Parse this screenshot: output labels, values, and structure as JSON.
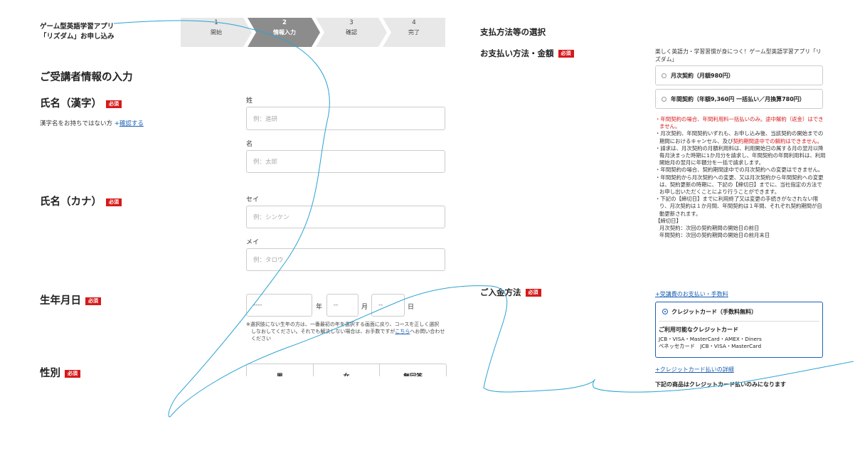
{
  "brand": {
    "line1": "ゲーム型英語学習アプリ",
    "line2": "「リズダム」お申し込み"
  },
  "steps": [
    {
      "num": "1",
      "label": "開始"
    },
    {
      "num": "2",
      "label": "情報入力"
    },
    {
      "num": "3",
      "label": "確認"
    },
    {
      "num": "4",
      "label": "完了"
    }
  ],
  "left": {
    "heading": "ご受講者情報の入力",
    "required": "必須",
    "name_kanji": {
      "title": "氏名（漢字）",
      "note_text": "漢字名をお持ちではない方",
      "note_link": "+確認する",
      "last_label": "姓",
      "last_placeholder": "例：進研",
      "first_label": "名",
      "first_placeholder": "例：太郎"
    },
    "name_kana": {
      "title": "氏名（カナ）",
      "last_label": "セイ",
      "last_placeholder": "例：シンケン",
      "first_label": "メイ",
      "first_placeholder": "例：タロウ"
    },
    "birthdate": {
      "title": "生年月日",
      "year_value": "----",
      "year_unit": "年",
      "month_value": "--",
      "month_unit": "月",
      "day_value": "--",
      "day_unit": "日",
      "note_a": "※選択肢にない生年の方は、一番最初の年を選択する画面に戻り、コースを正しく選択",
      "note_b": "しなおしてください。それでも解決しない場合は、お手数ですが",
      "note_link": "こちら",
      "note_c": "へお問い合わせ",
      "note_d": "ください"
    },
    "gender": {
      "title": "性別",
      "options": [
        "男",
        "女",
        "無回答"
      ]
    }
  },
  "right": {
    "heading": "支払方法等の選択",
    "payment_plan": {
      "title": "お支払い方法・金額",
      "intro": "楽しく英語力・学習習慣が身につく！ゲーム型英語学習アプリ「リズダム」",
      "option_monthly": "月次契約（月額980円）",
      "option_yearly": "年間契約（年額9,360円 一括払い／月換算780円）"
    },
    "terms": {
      "t1": "・年間契約の場合、年間利用料一括払いのみ。途中解約（返金）はできません。",
      "t2a": "・月次契約、年間契約いずれも、お申し込み後、当該契約の開始までの期間におけるキャンセル、及び",
      "t2b": "契約期間途中での解約はできません。",
      "t3": "・請求は、月次契約の月額利用料は、利用開始日の属する月の翌月以降毎月決まった時期に1か月分を請求し、年間契約の年間利用料は、利用開始月の翌月に年額分を一括で請求します。",
      "t4": "・年間契約の場合、契約期間途中での月次契約への変更はできません。",
      "t5": "・年間契約から月次契約への変更、又は月次契約から年間契約への変更は、契約更新の時期に、下記の【締切日】までに、当社指定の方法でお申し出いただくことにより行うことができます。",
      "t6": "・下記の【締切日】までに利用終了又は変更の手続きがなされない限り、月次契約は１か月間、年間契約は１年間、それぞれ契約期間が自動更新されます。",
      "deadline_title": "【締切日】",
      "deadline_monthly": "月次契約：次回の契約期間の開始日の前日",
      "deadline_yearly": "年間契約：次回の契約期間の開始日の前月末日"
    },
    "deposit": {
      "title": "ご入金方法",
      "fee_link": "+受講費のお支払い・手数料",
      "card_option": "クレジットカード（手数料無料）",
      "cards_title": "ご利用可能なクレジットカード",
      "cards_line1": "JCB・VISA・MasterCard・AMEX・Diners",
      "cards_line2": "ベネッセカード　JCB・VISA・MasterCard",
      "card_detail_link": "+クレジットカード払いの詳細",
      "only_card_note": "下記の商品はクレジットカード払いのみになります"
    }
  }
}
